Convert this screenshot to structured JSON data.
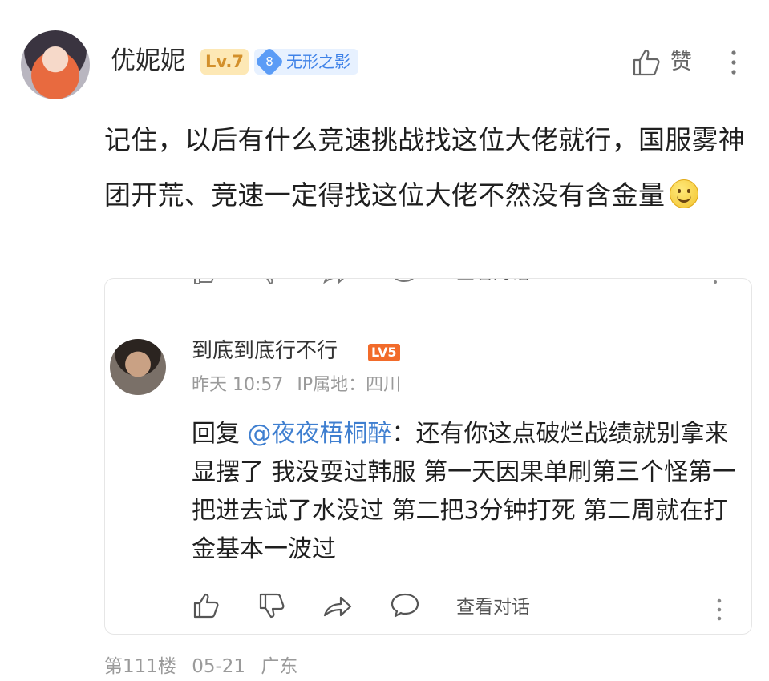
{
  "post": {
    "username": "优妮妮",
    "level_badge": "Lv.7",
    "fan_level": "8",
    "fan_badge": "无形之影",
    "like_label": "赞",
    "text": "记住，以后有什么竞速挑战找这位大佬就行，国服雾神团开荒、竞速一定得找这位大佬不然没有含金量",
    "emoji": "smile-emoji"
  },
  "quote": {
    "clipped_action_label": "查看对话",
    "reply": {
      "username": "到底到底行不行",
      "level_badge": "LV5",
      "time": "昨天 10:57",
      "ip_location": "IP属地：四川",
      "prefix": "回复 ",
      "mention": "@夜夜梧桐醉",
      "text": "：还有你这点破烂战绩就别拿来显摆了  我没耍过韩服  第一天因果单刷第三个怪第一把进去试了水没过  第二把3分钟打死   第二周就在打金基本一波过"
    },
    "actions": {
      "view_conversation_label": "查看对话"
    }
  },
  "footer": {
    "floor": "第111楼",
    "date": "05-21",
    "location": "广东"
  },
  "colors": {
    "mention": "#3f7fd0",
    "level_badge_bg": "#fde8b5",
    "fan_badge_bg": "#e7f1ff",
    "lv5_badge_bg": "#f26b2a"
  }
}
